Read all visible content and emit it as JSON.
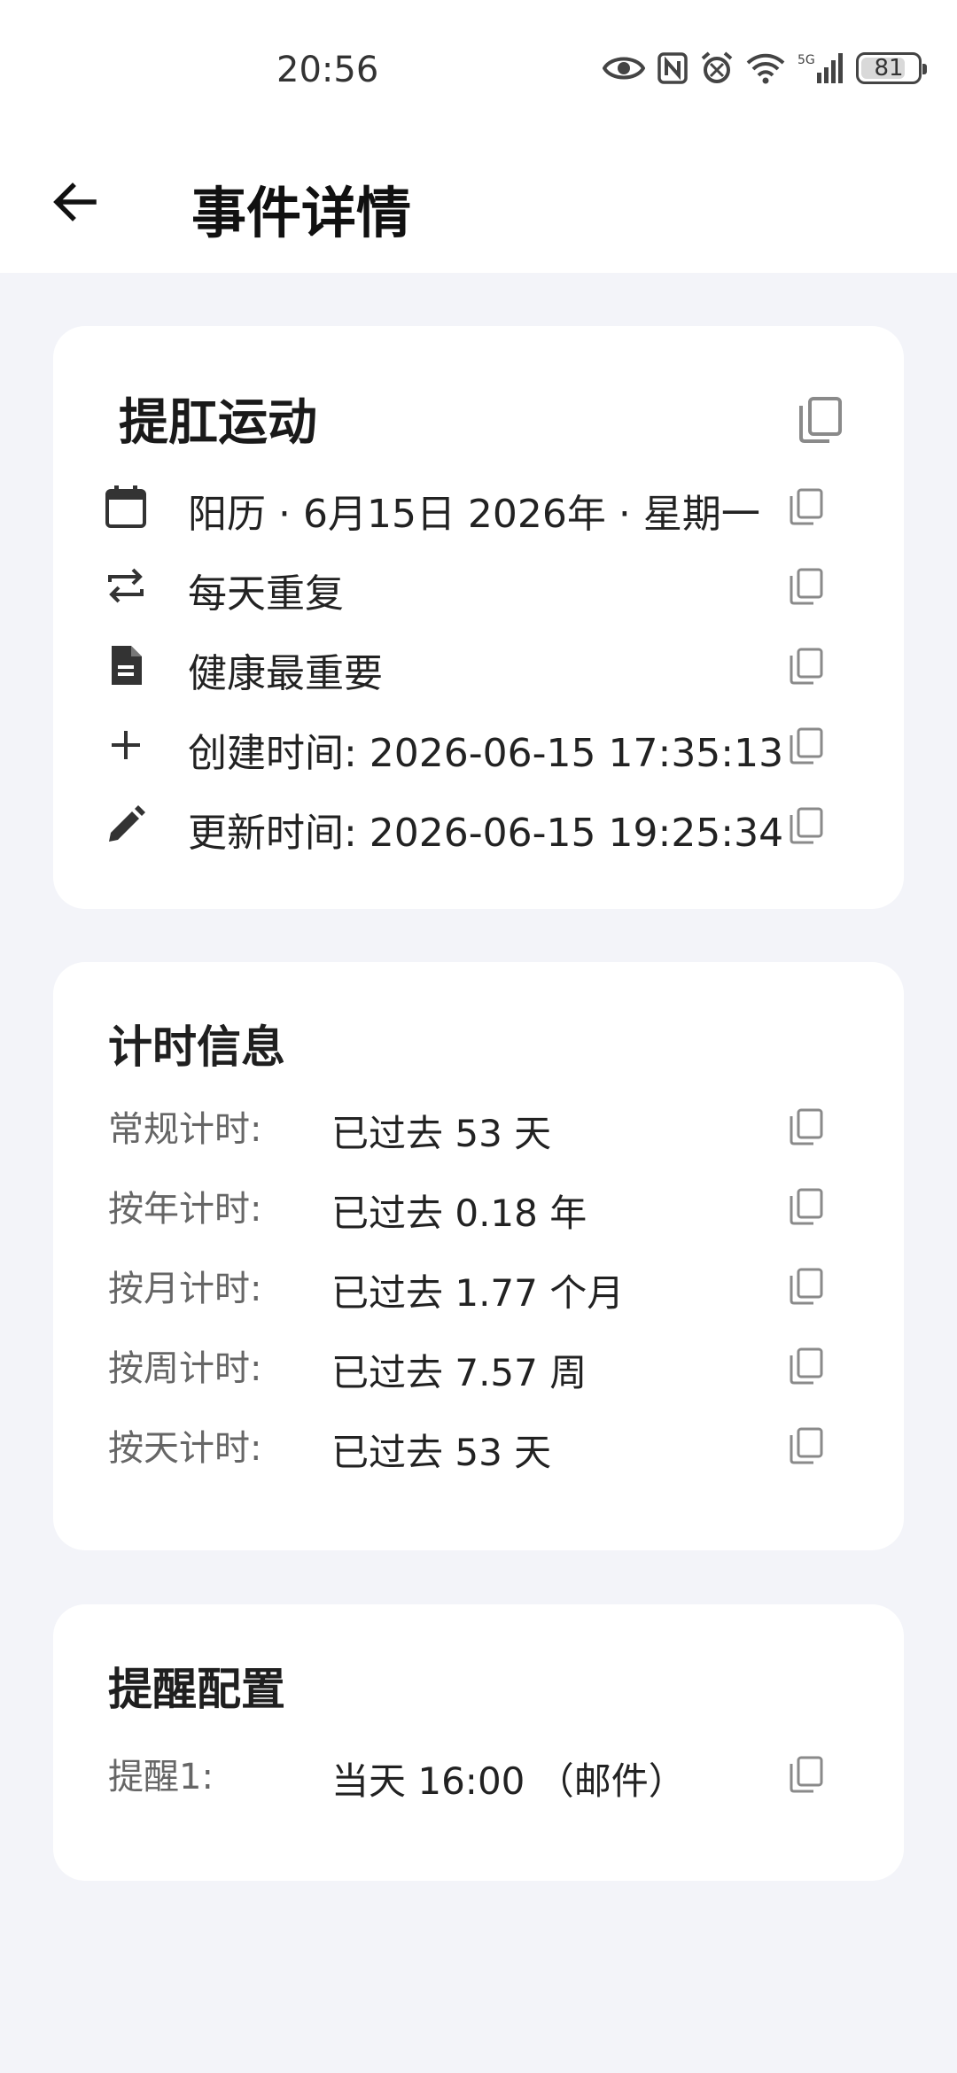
{
  "status_bar": {
    "time": "20:56",
    "network": "5G",
    "battery": "81",
    "icons": [
      "eye-icon",
      "nfc-icon",
      "alarm-icon",
      "wifi-icon",
      "signal-5g-icon",
      "battery-icon"
    ]
  },
  "app_bar": {
    "title": "事件详情",
    "back_icon": "arrow-back-icon"
  },
  "event": {
    "title": "提肛运动",
    "rows": [
      {
        "icon": "calendar-icon",
        "text": "阳历 · 6月15日 2026年 · 星期一"
      },
      {
        "icon": "repeat-icon",
        "text": "每天重复"
      },
      {
        "icon": "document-icon",
        "text": "健康最重要"
      },
      {
        "icon": "plus-icon",
        "text": "创建时间: 2026-06-15 17:35:13"
      },
      {
        "icon": "pencil-icon",
        "text": "更新时间: 2026-06-15 19:25:34"
      }
    ]
  },
  "timing": {
    "title": "计时信息",
    "rows": [
      {
        "label": "常规计时:",
        "value": "已过去 53 天"
      },
      {
        "label": "按年计时:",
        "value": "已过去 0.18 年"
      },
      {
        "label": "按月计时:",
        "value": "已过去 1.77 个月"
      },
      {
        "label": "按周计时:",
        "value": "已过去 7.57 周"
      },
      {
        "label": "按天计时:",
        "value": "已过去 53 天"
      }
    ]
  },
  "reminders": {
    "title": "提醒配置",
    "rows": [
      {
        "label": "提醒1:",
        "value": "当天 16:00 （邮件）"
      }
    ]
  },
  "colors": {
    "background": "#f3f4f9",
    "card": "#ffffff",
    "icon_gray": "#8a8a8a"
  }
}
